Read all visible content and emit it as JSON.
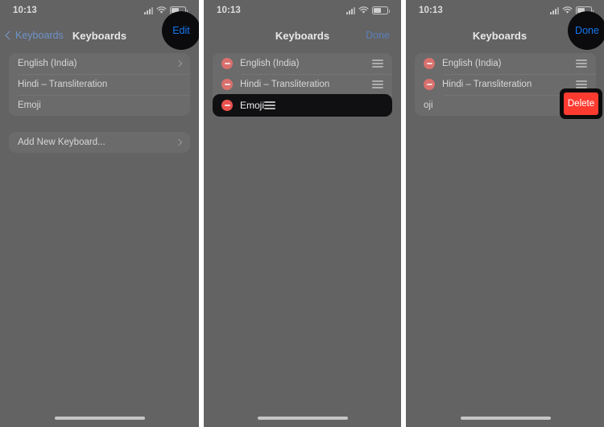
{
  "meta": {
    "platform": "ios-settings-keyboards",
    "background_color": "#636363",
    "accent_blue": "#1277f0",
    "delete_red": "#ff3b30",
    "minus_red": "#e8524f"
  },
  "status_bar": {
    "time": "10:13",
    "icons": [
      "cellular-signal-icon",
      "wifi-icon",
      "battery-icon"
    ]
  },
  "panels": [
    {
      "id": "panel-1",
      "nav": {
        "back_label": "Keyboards",
        "title": "Keyboards",
        "right_label": "Edit",
        "right_highlighted": true
      },
      "groups": [
        {
          "id": "keyboards-list",
          "rows": [
            {
              "label": "English (India)",
              "accessory": "chevron-right-icon"
            },
            {
              "label": "Hindi – Transliteration",
              "accessory": "none"
            },
            {
              "label": "Emoji",
              "accessory": "none"
            }
          ]
        },
        {
          "id": "add-keyboard-group",
          "rows": [
            {
              "label": "Add New Keyboard...",
              "accessory": "chevron-right-icon"
            }
          ]
        }
      ]
    },
    {
      "id": "panel-2",
      "nav": {
        "back_label": "",
        "title": "Keyboards",
        "right_label": "Done",
        "right_highlighted": false
      },
      "groups": [
        {
          "id": "keyboards-list-editing",
          "rows": [
            {
              "label": "English (India)",
              "accessory": "reorder-handle-icon",
              "leading": "minus-circle-icon"
            },
            {
              "label": "Hindi – Transliteration",
              "accessory": "reorder-handle-icon",
              "leading": "minus-circle-icon"
            },
            {
              "label": "Emoji",
              "accessory": "reorder-handle-icon",
              "leading": "minus-circle-icon"
            }
          ]
        }
      ],
      "highlighted_row_label": "Emoji"
    },
    {
      "id": "panel-3",
      "nav": {
        "back_label": "",
        "title": "Keyboards",
        "right_label": "Done",
        "right_highlighted": true
      },
      "groups": [
        {
          "id": "keyboards-list-swiped",
          "rows": [
            {
              "label": "English (India)",
              "accessory": "reorder-handle-icon",
              "leading": "minus-circle-icon"
            },
            {
              "label": "Hindi – Transliteration",
              "accessory": "reorder-handle-icon",
              "leading": "minus-circle-icon"
            }
          ]
        }
      ],
      "swiped_row_remnant": "oji",
      "delete_button_label": "Delete"
    }
  ]
}
